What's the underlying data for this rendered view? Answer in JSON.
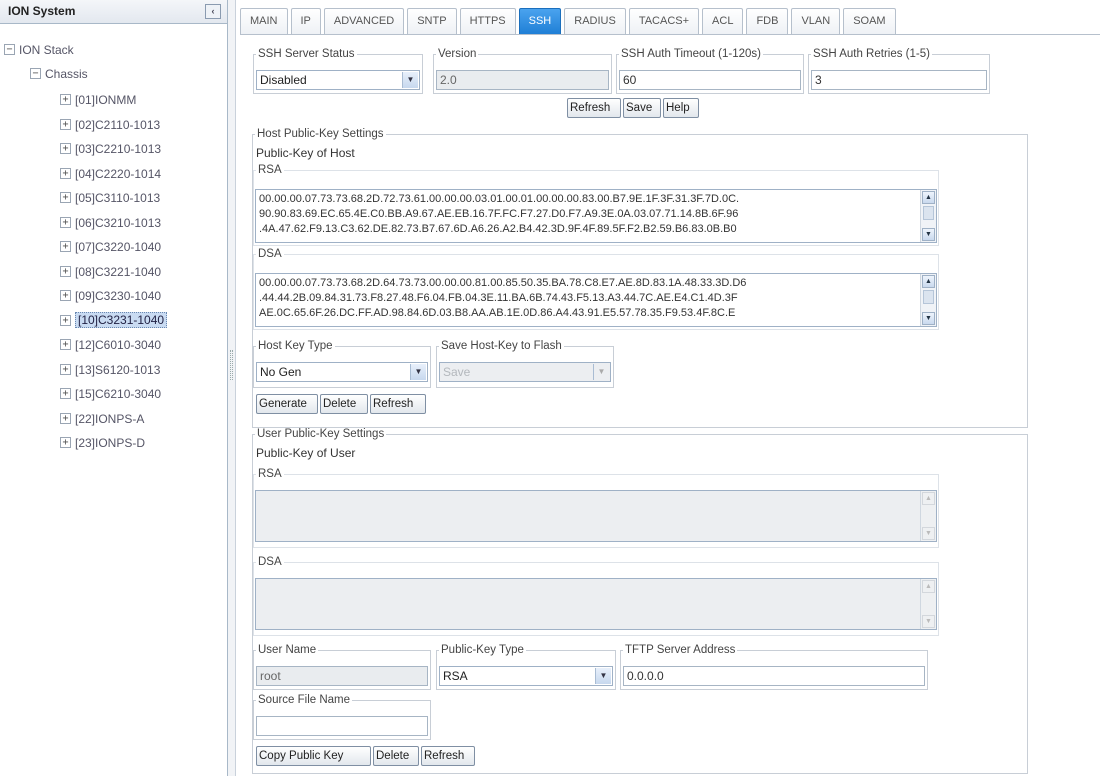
{
  "tree": {
    "title": "ION System",
    "collapse_icon": "‹",
    "root": "ION Stack",
    "chassis": "Chassis",
    "items": [
      {
        "label": "[01]IONMM"
      },
      {
        "label": "[02]C2110-1013"
      },
      {
        "label": "[03]C2210-1013"
      },
      {
        "label": "[04]C2220-1014"
      },
      {
        "label": "[05]C3110-1013"
      },
      {
        "label": "[06]C3210-1013"
      },
      {
        "label": "[07]C3220-1040"
      },
      {
        "label": "[08]C3221-1040"
      },
      {
        "label": "[09]C3230-1040"
      },
      {
        "label": "[10]C3231-1040"
      },
      {
        "label": "[12]C6010-3040"
      },
      {
        "label": "[13]S6120-1013"
      },
      {
        "label": "[15]C6210-3040"
      },
      {
        "label": "[22]IONPS-A"
      },
      {
        "label": "[23]IONPS-D"
      }
    ],
    "selected_index": 9
  },
  "tabs": [
    "MAIN",
    "IP",
    "ADVANCED",
    "SNTP",
    "HTTPS",
    "SSH",
    "RADIUS",
    "TACACS+",
    "ACL",
    "FDB",
    "VLAN",
    "SOAM"
  ],
  "active_tab": "SSH",
  "ssh_server": {
    "status_legend": "SSH Server Status",
    "status_value": "Disabled",
    "version_legend": "Version",
    "version_value": "2.0",
    "timeout_legend": "SSH Auth Timeout (1-120s)",
    "timeout_value": "60",
    "retries_legend": "SSH Auth Retries (1-5)",
    "retries_value": "3",
    "refresh": "Refresh",
    "save": "Save",
    "help": "Help"
  },
  "host_keys": {
    "legend": "Host Public-Key Settings",
    "subtitle": "Public-Key of Host",
    "rsa_label": "RSA",
    "rsa_lines": [
      "00.00.00.07.73.73.68.2D.72.73.61.00.00.00.03.01.00.01.00.00.00.83.00.B7.9E.1F.3F.31.3F.7D.0C.",
      "90.90.83.69.EC.65.4E.C0.BB.A9.67.AE.EB.16.7F.FC.F7.27.D0.F7.A9.3E.0A.03.07.71.14.8B.6F.96",
      ".4A.47.62.F9.13.C3.62.DE.82.73.B7.67.6D.A6.26.A2.B4.42.3D.9F.4F.89.5F.F2.B2.59.B6.83.0B.B0"
    ],
    "dsa_label": "DSA",
    "dsa_lines": [
      "00.00.00.07.73.73.68.2D.64.73.73.00.00.00.81.00.85.50.35.BA.78.C8.E7.AE.8D.83.1A.48.33.3D.D6",
      ".44.44.2B.09.84.31.73.F8.27.48.F6.04.FB.04.3E.11.BA.6B.74.43.F5.13.A3.44.7C.AE.E4.C1.4D.3F",
      "AE.0C.65.6F.26.DC.FF.AD.98.84.6D.03.B8.AA.AB.1E.0D.86.A4.43.91.E5.57.78.35.F9.53.4F.8C.E"
    ],
    "key_type_legend": "Host Key Type",
    "key_type_value": "No Gen",
    "save_flash_legend": "Save Host-Key to Flash",
    "save_flash_value": "Save",
    "generate": "Generate",
    "delete": "Delete",
    "refresh": "Refresh"
  },
  "user_keys": {
    "legend": "User Public-Key Settings",
    "subtitle": "Public-Key of User",
    "rsa_label": "RSA",
    "dsa_label": "DSA",
    "user_name_legend": "User Name",
    "user_name_value": "root",
    "pk_type_legend": "Public-Key Type",
    "pk_type_value": "RSA",
    "tftp_legend": "TFTP Server Address",
    "tftp_value": "0.0.0.0",
    "source_file_legend": "Source File Name",
    "source_file_value": "",
    "copy_key": "Copy Public Key",
    "delete": "Delete",
    "refresh": "Refresh"
  }
}
